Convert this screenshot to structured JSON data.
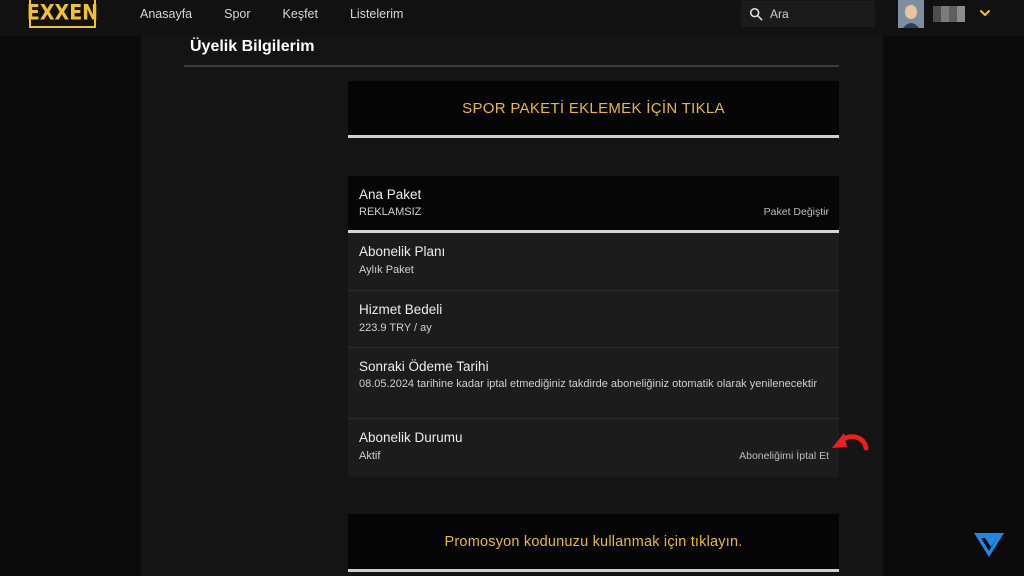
{
  "brand": {
    "logo_text": "EXXEN",
    "accent": "#f2c12e"
  },
  "nav": {
    "items": [
      "Anasayfa",
      "Spor",
      "Keşfet",
      "Listelerim"
    ]
  },
  "search": {
    "placeholder": "Ara",
    "icon": "search-icon"
  },
  "user": {
    "avatar_icon": "avatar",
    "menu_icon": "chevron-down-icon"
  },
  "page": {
    "title": "Üyelik Bilgilerim",
    "sport_cta": "SPOR PAKETİ EKLEMEK İÇİN TIKLA",
    "promo_cta": "Promosyon kodunuzu kullanmak için tıklayın."
  },
  "subscription": {
    "main_package": {
      "label": "Ana Paket",
      "value": "REKLAMSIZ",
      "action": "Paket Değiştir"
    },
    "plan": {
      "label": "Abonelik Planı",
      "value": "Aylık Paket"
    },
    "fee": {
      "label": "Hizmet Bedeli",
      "value": "223.9 TRY / ay"
    },
    "next_payment": {
      "label": "Sonraki Ödeme Tarihi",
      "value": "08.05.2024 tarihine kadar iptal etmediğiniz takdirde aboneliğiniz otomatik olarak yenilenecektir"
    },
    "status": {
      "label": "Abonelik Durumu",
      "value": "Aktif",
      "action": "Aboneliğimi İptal Et"
    }
  },
  "colors": {
    "cta_text": "#e6b93a",
    "annotation_arrow": "#e8201e"
  }
}
